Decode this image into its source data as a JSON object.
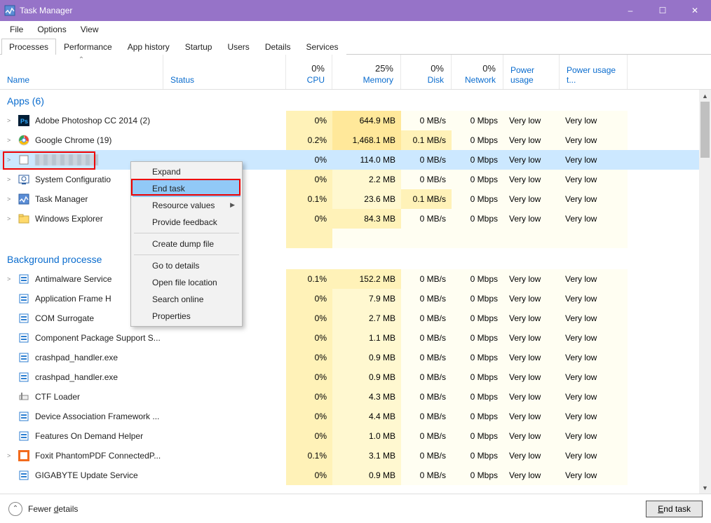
{
  "title": "Task Manager",
  "window_controls": {
    "min": "–",
    "max": "☐",
    "close": "✕"
  },
  "menubar": [
    "File",
    "Options",
    "View"
  ],
  "tabs": [
    "Processes",
    "Performance",
    "App history",
    "Startup",
    "Users",
    "Details",
    "Services"
  ],
  "active_tab": 0,
  "columns": {
    "name": "Name",
    "status": "Status",
    "cpu": "CPU",
    "memory": "Memory",
    "disk": "Disk",
    "network": "Network",
    "pu": "Power usage",
    "put": "Power usage t..."
  },
  "header_values": {
    "cpu": "0%",
    "memory": "25%",
    "disk": "0%",
    "network": "0%"
  },
  "groups": {
    "apps": "Apps (6)",
    "bg": "Background processe"
  },
  "rows": [
    {
      "g": "apps",
      "exp": true,
      "icon": "ps",
      "name": "Adobe Photoshop CC 2014 (2)",
      "cpu": "0%",
      "mem": "644.9 MB",
      "disk": "0 MB/s",
      "net": "0 Mbps",
      "pu": "Very low",
      "put": "Very low",
      "memTint": "med"
    },
    {
      "g": "apps",
      "exp": true,
      "icon": "chrome",
      "name": "Google Chrome (19)",
      "cpu": "0.2%",
      "mem": "1,468.1 MB",
      "disk": "0.1 MB/s",
      "net": "0 Mbps",
      "pu": "Very low",
      "put": "Very low",
      "memTint": "med",
      "diskTint": "light"
    },
    {
      "g": "apps",
      "exp": true,
      "icon": "blur",
      "name": "[redacted]",
      "cpu": "0%",
      "mem": "114.0 MB",
      "disk": "0 MB/s",
      "net": "0 Mbps",
      "pu": "Very low",
      "put": "Very low",
      "memTint": "light",
      "selected": true,
      "blur": true
    },
    {
      "g": "apps",
      "exp": true,
      "icon": "syscfg",
      "name": "System Configuratio",
      "cpu": "0%",
      "mem": "2.2 MB",
      "disk": "0 MB/s",
      "net": "0 Mbps",
      "pu": "Very low",
      "put": "Very low",
      "memTint": "faint"
    },
    {
      "g": "apps",
      "exp": true,
      "icon": "taskmgr",
      "name": "Task Manager",
      "cpu": "0.1%",
      "mem": "23.6 MB",
      "disk": "0.1 MB/s",
      "net": "0 Mbps",
      "pu": "Very low",
      "put": "Very low",
      "memTint": "faint",
      "diskTint": "light"
    },
    {
      "g": "apps",
      "exp": true,
      "icon": "explorer",
      "name": "Windows Explorer",
      "cpu": "0%",
      "mem": "84.3 MB",
      "disk": "0 MB/s",
      "net": "0 Mbps",
      "pu": "Very low",
      "put": "Very low",
      "memTint": "light"
    },
    {
      "g": "bg",
      "exp": true,
      "icon": "proc",
      "name": "Antimalware Service",
      "cpu": "0.1%",
      "mem": "152.2 MB",
      "disk": "0 MB/s",
      "net": "0 Mbps",
      "pu": "Very low",
      "put": "Very low",
      "memTint": "light"
    },
    {
      "g": "bg",
      "exp": false,
      "icon": "proc",
      "name": "Application Frame H",
      "cpu": "0%",
      "mem": "7.9 MB",
      "disk": "0 MB/s",
      "net": "0 Mbps",
      "pu": "Very low",
      "put": "Very low",
      "memTint": "faint"
    },
    {
      "g": "bg",
      "exp": false,
      "icon": "proc",
      "name": "COM Surrogate",
      "cpu": "0%",
      "mem": "2.7 MB",
      "disk": "0 MB/s",
      "net": "0 Mbps",
      "pu": "Very low",
      "put": "Very low",
      "memTint": "faint"
    },
    {
      "g": "bg",
      "exp": false,
      "icon": "proc",
      "name": "Component Package Support S...",
      "cpu": "0%",
      "mem": "1.1 MB",
      "disk": "0 MB/s",
      "net": "0 Mbps",
      "pu": "Very low",
      "put": "Very low",
      "memTint": "faint"
    },
    {
      "g": "bg",
      "exp": false,
      "icon": "proc",
      "name": "crashpad_handler.exe",
      "cpu": "0%",
      "mem": "0.9 MB",
      "disk": "0 MB/s",
      "net": "0 Mbps",
      "pu": "Very low",
      "put": "Very low",
      "memTint": "faint"
    },
    {
      "g": "bg",
      "exp": false,
      "icon": "proc",
      "name": "crashpad_handler.exe",
      "cpu": "0%",
      "mem": "0.9 MB",
      "disk": "0 MB/s",
      "net": "0 Mbps",
      "pu": "Very low",
      "put": "Very low",
      "memTint": "faint"
    },
    {
      "g": "bg",
      "exp": false,
      "icon": "ctf",
      "name": "CTF Loader",
      "cpu": "0%",
      "mem": "4.3 MB",
      "disk": "0 MB/s",
      "net": "0 Mbps",
      "pu": "Very low",
      "put": "Very low",
      "memTint": "faint"
    },
    {
      "g": "bg",
      "exp": false,
      "icon": "proc",
      "name": "Device Association Framework ...",
      "cpu": "0%",
      "mem": "4.4 MB",
      "disk": "0 MB/s",
      "net": "0 Mbps",
      "pu": "Very low",
      "put": "Very low",
      "memTint": "faint"
    },
    {
      "g": "bg",
      "exp": false,
      "icon": "proc",
      "name": "Features On Demand Helper",
      "cpu": "0%",
      "mem": "1.0 MB",
      "disk": "0 MB/s",
      "net": "0 Mbps",
      "pu": "Very low",
      "put": "Very low",
      "memTint": "faint"
    },
    {
      "g": "bg",
      "exp": true,
      "icon": "foxit",
      "name": "Foxit PhantomPDF ConnectedP...",
      "cpu": "0.1%",
      "mem": "3.1 MB",
      "disk": "0 MB/s",
      "net": "0 Mbps",
      "pu": "Very low",
      "put": "Very low",
      "memTint": "faint"
    },
    {
      "g": "bg",
      "exp": false,
      "icon": "proc",
      "name": "GIGABYTE Update Service",
      "cpu": "0%",
      "mem": "0.9 MB",
      "disk": "0 MB/s",
      "net": "0 Mbps",
      "pu": "Very low",
      "put": "Very low",
      "memTint": "faint"
    }
  ],
  "context_menu": {
    "items": [
      {
        "label": "Expand"
      },
      {
        "label": "End task",
        "hover": true,
        "redbox": true
      },
      {
        "label": "Resource values",
        "sub": true
      },
      {
        "label": "Provide feedback"
      },
      {
        "sep": true
      },
      {
        "label": "Create dump file"
      },
      {
        "sep": true
      },
      {
        "label": "Go to details"
      },
      {
        "label": "Open file location"
      },
      {
        "label": "Search online"
      },
      {
        "label": "Properties"
      }
    ]
  },
  "footer": {
    "fewer_pre": "Fewer ",
    "fewer_u": "d",
    "fewer_post": "etails",
    "end_pre": "",
    "end_u": "E",
    "end_post": "nd task"
  }
}
